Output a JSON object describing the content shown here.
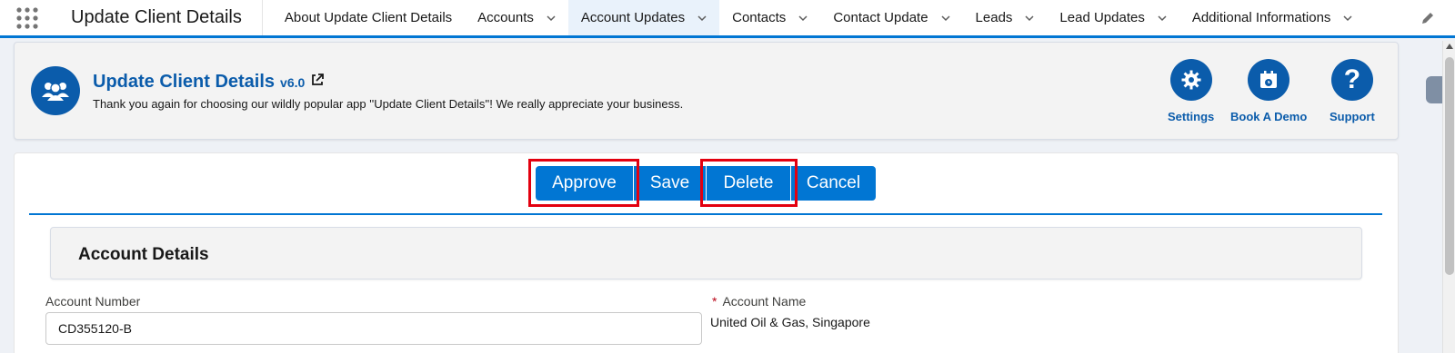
{
  "nav": {
    "app_name": "Update Client Details",
    "tabs": [
      {
        "label": "About Update Client Details",
        "dropdown": false
      },
      {
        "label": "Accounts",
        "dropdown": true
      },
      {
        "label": "Account Updates",
        "dropdown": true,
        "active": true
      },
      {
        "label": "Contacts",
        "dropdown": true
      },
      {
        "label": "Contact Update",
        "dropdown": true
      },
      {
        "label": "Leads",
        "dropdown": true
      },
      {
        "label": "Lead Updates",
        "dropdown": true
      },
      {
        "label": "Additional Informations",
        "dropdown": true
      }
    ],
    "icons": [
      "app-launcher-icon",
      "chevron-down-icon",
      "edit-pencil-icon"
    ]
  },
  "header": {
    "title": "Update Client Details",
    "version": "v6.0",
    "subtitle": "Thank you again for choosing our wildly popular app ''Update Client Details''! We really appreciate your business.",
    "actions": [
      {
        "label": "Settings",
        "icon": "gear-icon"
      },
      {
        "label": "Book A Demo",
        "icon": "calendar-icon"
      },
      {
        "label": "Support",
        "icon": "question-icon"
      }
    ]
  },
  "buttons": {
    "approve": "Approve",
    "save": "Save",
    "delete": "Delete",
    "cancel": "Cancel"
  },
  "section": {
    "title": "Account Details"
  },
  "fields": {
    "account_number": {
      "label": "Account Number",
      "value": "CD355120-B"
    },
    "account_name": {
      "label": "Account Name",
      "required_mark": "*",
      "value": "United Oil & Gas, Singapore"
    }
  },
  "colors": {
    "brand": "#0176d3",
    "header_blue": "#0b5cab",
    "highlight": "#e3000f"
  }
}
